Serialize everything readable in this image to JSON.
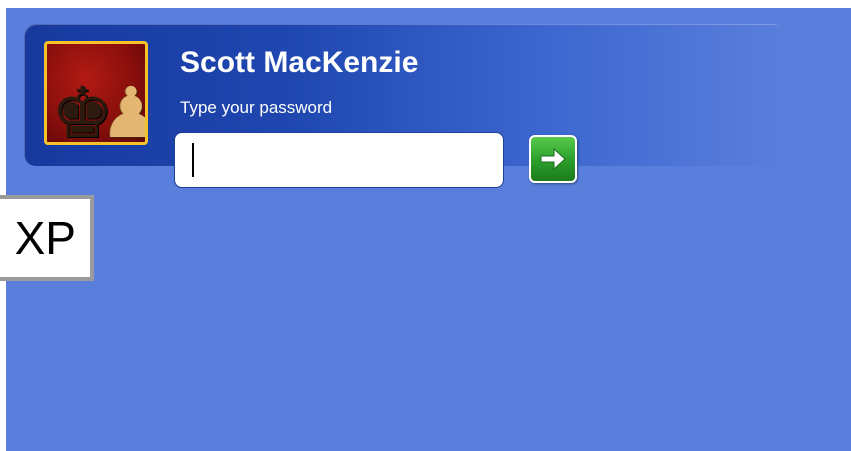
{
  "login": {
    "username": "Scott MacKenzie",
    "prompt": "Type your password",
    "password_value": "",
    "avatar_icon": "chess-pieces-icon",
    "go_icon": "right-arrow-icon"
  },
  "overlay": {
    "label": "XP"
  },
  "colors": {
    "background": "#5a7edc",
    "tile": "#17399e",
    "avatar_border": "#f5c22c",
    "go_button": "#2a9e2a"
  }
}
